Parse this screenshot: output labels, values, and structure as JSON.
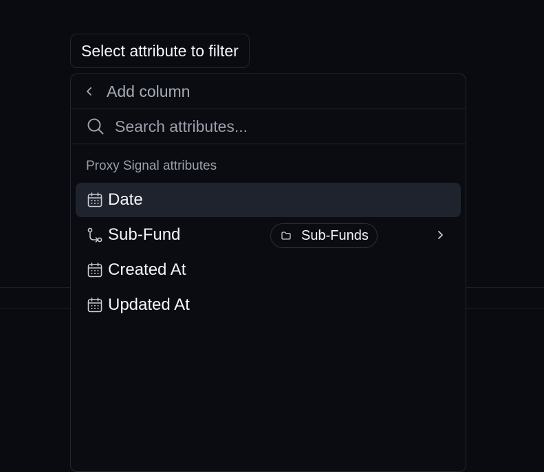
{
  "tooltip": {
    "text": "Select attribute to filter"
  },
  "panel": {
    "header_title": "Add column",
    "search": {
      "value": "",
      "placeholder": "Search attributes..."
    },
    "section_label": "Proxy Signal attributes",
    "items": [
      {
        "label": "Date",
        "icon": "calendar-icon",
        "selected": true
      },
      {
        "label": "Sub-Fund",
        "icon": "relation-icon",
        "selected": false,
        "badge": {
          "label": "Sub-Funds",
          "icon": "folder-icon"
        },
        "has_submenu": true
      },
      {
        "label": "Created At",
        "icon": "calendar-icon",
        "selected": false
      },
      {
        "label": "Updated At",
        "icon": "calendar-icon",
        "selected": false
      }
    ]
  },
  "colors": {
    "background": "#090b11",
    "panel_border": "#22262f",
    "selected_row": "#1f232d",
    "text_primary": "#f4f5f7",
    "text_muted": "#9aa0ab"
  }
}
